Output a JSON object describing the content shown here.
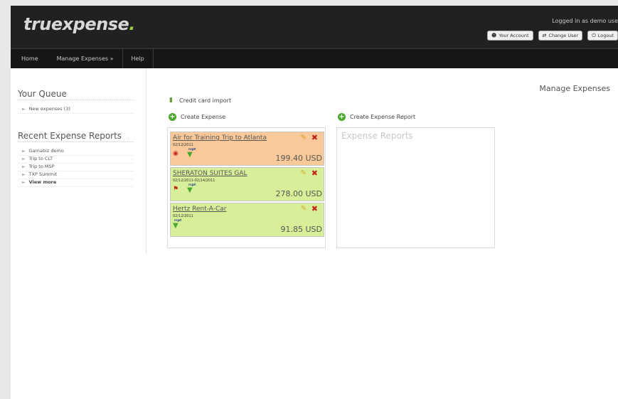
{
  "header": {
    "logo_main": "truexpense",
    "logo_dot": ".",
    "logged_in": "Logged in as demo use",
    "buttons": [
      {
        "icon": "user-icon",
        "label": "Your Account"
      },
      {
        "icon": "swap-icon",
        "label": "Change User"
      },
      {
        "icon": "power-icon",
        "label": "Logout"
      }
    ]
  },
  "nav": {
    "items": [
      "Home",
      "Manage Expenses »",
      "Help"
    ]
  },
  "sidebar": {
    "queue_title": "Your Queue",
    "queue_items": [
      "New expenses (3)"
    ],
    "reports_title": "Recent Expense Reports",
    "report_items": [
      "Gamabiz demo",
      "Trip to CLT",
      "Trip to MSP",
      "TXP Summit"
    ],
    "view_more": "View more"
  },
  "main": {
    "page_title": "Manage Expenses",
    "credit_card_import": "Credit card import",
    "create_expense": "Create Expense",
    "create_report": "Create Expense Report",
    "reports_panel_title": "Expense Reports"
  },
  "expenses": [
    {
      "name": "Air for Training Trip to Atlanta",
      "date": "02/12/2011",
      "amount": "199.40 USD",
      "color": "#f9c99a",
      "icons": [
        "receipt-icon",
        "download-icon"
      ],
      "receipt_tag": "rcpt"
    },
    {
      "name": "SHERATON SUITES GAL",
      "date": "02/12/2011-02/14/2011",
      "amount": "278.00 USD",
      "color": "#d8ef9a",
      "icons": [
        "flag-icon",
        "download-icon"
      ],
      "receipt_tag": "rcpt"
    },
    {
      "name": "Hertz Rent-A-Car",
      "date": "02/12/2011",
      "amount": "91.85 USD",
      "color": "#d8ef9a",
      "icons": [
        "download-icon"
      ],
      "receipt_tag": "rcpt"
    }
  ],
  "colors": {
    "header_bg": "#212121",
    "nav_bg": "#161616",
    "accent_green": "#4aa82e",
    "delete_red": "#c0241a",
    "card_orange": "#f9c99a",
    "card_green": "#d8ef9a"
  }
}
